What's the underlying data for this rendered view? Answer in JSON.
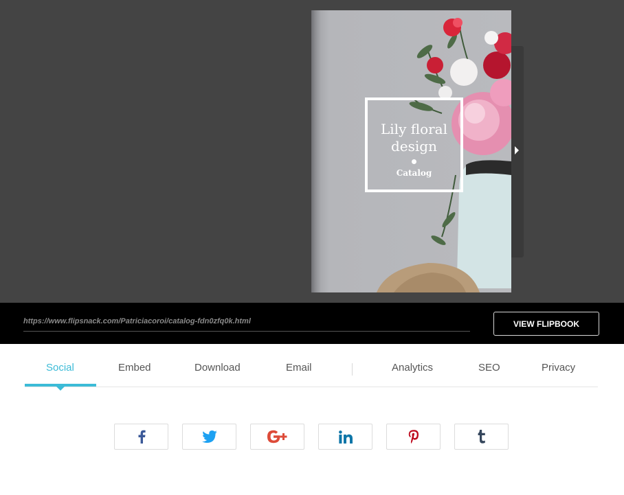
{
  "cover": {
    "title_line1": "Lily floral",
    "title_line2": "design",
    "subtitle": "Catalog"
  },
  "urlbar": {
    "url": "https://www.flipsnack.com/Patriciacoroi/catalog-fdn0zfq0k.html",
    "view_button": "VIEW FLIPBOOK"
  },
  "tabs": [
    {
      "label": "Social",
      "active": true
    },
    {
      "label": "Embed",
      "active": false
    },
    {
      "label": "Download",
      "active": false
    },
    {
      "label": "Email",
      "active": false
    },
    {
      "label": "Analytics",
      "active": false
    },
    {
      "label": "SEO",
      "active": false
    },
    {
      "label": "Privacy",
      "active": false
    }
  ],
  "social_buttons": [
    {
      "name": "facebook-icon",
      "color": "#3b5998"
    },
    {
      "name": "twitter-icon",
      "color": "#1da1f2"
    },
    {
      "name": "google-plus-icon",
      "color": "#dd4b39"
    },
    {
      "name": "linkedin-icon",
      "color": "#0e76a8"
    },
    {
      "name": "pinterest-icon",
      "color": "#bd081c"
    },
    {
      "name": "tumblr-icon",
      "color": "#35465c"
    }
  ],
  "colors": {
    "accent": "#3cbbd7",
    "viewer_bg": "#444444",
    "urlbar_bg": "#000000"
  }
}
